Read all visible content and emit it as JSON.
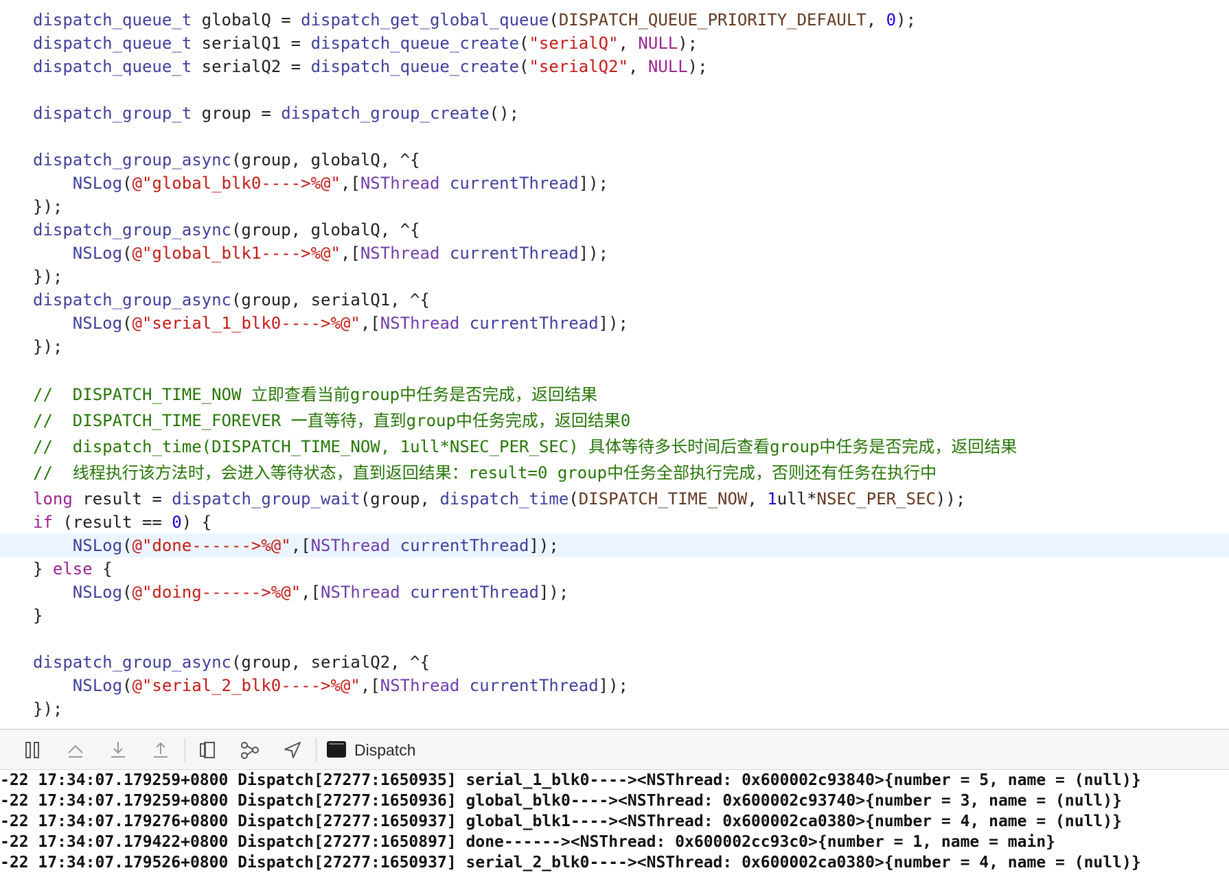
{
  "editor": {
    "lines": [
      [
        [
          "type",
          "dispatch_queue_t"
        ],
        [
          "plain",
          " globalQ = "
        ],
        [
          "func",
          "dispatch_get_global_queue"
        ],
        [
          "plain",
          "("
        ],
        [
          "macro",
          "DISPATCH_QUEUE_PRIORITY_DEFAULT"
        ],
        [
          "plain",
          ", "
        ],
        [
          "num",
          "0"
        ],
        [
          "plain",
          ");"
        ]
      ],
      [
        [
          "type",
          "dispatch_queue_t"
        ],
        [
          "plain",
          " serialQ1 = "
        ],
        [
          "func",
          "dispatch_queue_create"
        ],
        [
          "plain",
          "("
        ],
        [
          "str",
          "\"serialQ\""
        ],
        [
          "plain",
          ", "
        ],
        [
          "kw",
          "NULL"
        ],
        [
          "plain",
          ");"
        ]
      ],
      [
        [
          "type",
          "dispatch_queue_t"
        ],
        [
          "plain",
          " serialQ2 = "
        ],
        [
          "func",
          "dispatch_queue_create"
        ],
        [
          "plain",
          "("
        ],
        [
          "str",
          "\"serialQ2\""
        ],
        [
          "plain",
          ", "
        ],
        [
          "kw",
          "NULL"
        ],
        [
          "plain",
          ");"
        ]
      ],
      [],
      [
        [
          "type",
          "dispatch_group_t"
        ],
        [
          "plain",
          " group = "
        ],
        [
          "func",
          "dispatch_group_create"
        ],
        [
          "plain",
          "();"
        ]
      ],
      [],
      [
        [
          "func",
          "dispatch_group_async"
        ],
        [
          "plain",
          "(group, globalQ, ^{"
        ]
      ],
      [
        [
          "plain",
          "    "
        ],
        [
          "func",
          "NSLog"
        ],
        [
          "plain",
          "("
        ],
        [
          "str",
          "@\"global_blk0---->%@\""
        ],
        [
          "plain",
          ",["
        ],
        [
          "cls",
          "NSThread"
        ],
        [
          "plain",
          " "
        ],
        [
          "func",
          "currentThread"
        ],
        [
          "plain",
          "]);"
        ]
      ],
      [
        [
          "plain",
          "});"
        ]
      ],
      [
        [
          "func",
          "dispatch_group_async"
        ],
        [
          "plain",
          "(group, globalQ, ^{"
        ]
      ],
      [
        [
          "plain",
          "    "
        ],
        [
          "func",
          "NSLog"
        ],
        [
          "plain",
          "("
        ],
        [
          "str",
          "@\"global_blk1---->%@\""
        ],
        [
          "plain",
          ",["
        ],
        [
          "cls",
          "NSThread"
        ],
        [
          "plain",
          " "
        ],
        [
          "func",
          "currentThread"
        ],
        [
          "plain",
          "]);"
        ]
      ],
      [
        [
          "plain",
          "});"
        ]
      ],
      [
        [
          "func",
          "dispatch_group_async"
        ],
        [
          "plain",
          "(group, serialQ1, ^{"
        ]
      ],
      [
        [
          "plain",
          "    "
        ],
        [
          "func",
          "NSLog"
        ],
        [
          "plain",
          "("
        ],
        [
          "str",
          "@\"serial_1_blk0---->%@\""
        ],
        [
          "plain",
          ",["
        ],
        [
          "cls",
          "NSThread"
        ],
        [
          "plain",
          " "
        ],
        [
          "func",
          "currentThread"
        ],
        [
          "plain",
          "]);"
        ]
      ],
      [
        [
          "plain",
          "});"
        ]
      ],
      [],
      [
        [
          "cmt",
          "//  DISPATCH_TIME_NOW 立即查看当前group中任务是否完成，返回结果"
        ]
      ],
      [
        [
          "cmt",
          "//  DISPATCH_TIME_FOREVER 一直等待，直到group中任务完成，返回结果0"
        ]
      ],
      [
        [
          "cmt",
          "//  dispatch_time(DISPATCH_TIME_NOW, 1ull*NSEC_PER_SEC) 具体等待多长时间后查看group中任务是否完成，返回结果"
        ]
      ],
      [
        [
          "cmt",
          "//  线程执行该方法时，会进入等待状态，直到返回结果：result=0 group中任务全部执行完成，否则还有任务在执行中"
        ]
      ],
      [
        [
          "kw",
          "long"
        ],
        [
          "plain",
          " result = "
        ],
        [
          "func",
          "dispatch_group_wait"
        ],
        [
          "plain",
          "(group, "
        ],
        [
          "func",
          "dispatch_time"
        ],
        [
          "plain",
          "("
        ],
        [
          "macro",
          "DISPATCH_TIME_NOW"
        ],
        [
          "plain",
          ", "
        ],
        [
          "num",
          "1"
        ],
        [
          "plain",
          "ull*"
        ],
        [
          "macro",
          "NSEC_PER_SEC"
        ],
        [
          "plain",
          "));"
        ]
      ],
      [
        [
          "kw",
          "if"
        ],
        [
          "plain",
          " (result == "
        ],
        [
          "num",
          "0"
        ],
        [
          "plain",
          ") {"
        ]
      ],
      [
        [
          "plain",
          "    "
        ],
        [
          "func",
          "NSLog"
        ],
        [
          "plain",
          "("
        ],
        [
          "str",
          "@\"done------>%@\""
        ],
        [
          "plain",
          ",["
        ],
        [
          "cls",
          "NSThread"
        ],
        [
          "plain",
          " "
        ],
        [
          "func",
          "currentThread"
        ],
        [
          "plain",
          "]);"
        ]
      ],
      [
        [
          "plain",
          "} "
        ],
        [
          "kw",
          "else"
        ],
        [
          "plain",
          " {"
        ]
      ],
      [
        [
          "plain",
          "    "
        ],
        [
          "func",
          "NSLog"
        ],
        [
          "plain",
          "("
        ],
        [
          "str",
          "@\"doing------>%@\""
        ],
        [
          "plain",
          ",["
        ],
        [
          "cls",
          "NSThread"
        ],
        [
          "plain",
          " "
        ],
        [
          "func",
          "currentThread"
        ],
        [
          "plain",
          "]);"
        ]
      ],
      [
        [
          "plain",
          "}"
        ]
      ],
      [],
      [
        [
          "func",
          "dispatch_group_async"
        ],
        [
          "plain",
          "(group, serialQ2, ^{"
        ]
      ],
      [
        [
          "plain",
          "    "
        ],
        [
          "func",
          "NSLog"
        ],
        [
          "plain",
          "("
        ],
        [
          "str",
          "@\"serial_2_blk0---->%@\""
        ],
        [
          "plain",
          ",["
        ],
        [
          "cls",
          "NSThread"
        ],
        [
          "plain",
          " "
        ],
        [
          "func",
          "currentThread"
        ],
        [
          "plain",
          "]);"
        ]
      ],
      [
        [
          "plain",
          "});"
        ]
      ]
    ]
  },
  "debug_bar": {
    "target_label": "Dispatch",
    "icons": [
      "toggle-console-icon",
      "step-over-icon",
      "step-into-icon",
      "step-out-icon",
      "view-hierarchy-icon",
      "memory-graph-icon",
      "simulate-location-icon"
    ]
  },
  "console": {
    "lines": [
      "-22 17:34:07.179259+0800 Dispatch[27277:1650935] serial_1_blk0----><NSThread: 0x600002c93840>{number = 5, name = (null)}",
      "-22 17:34:07.179259+0800 Dispatch[27277:1650936] global_blk0----><NSThread: 0x600002c93740>{number = 3, name = (null)}",
      "-22 17:34:07.179276+0800 Dispatch[27277:1650937] global_blk1----><NSThread: 0x600002ca0380>{number = 4, name = (null)}",
      "-22 17:34:07.179422+0800 Dispatch[27277:1650897] done------><NSThread: 0x600002cc93c0>{number = 1, name = main}",
      "-22 17:34:07.179526+0800 Dispatch[27277:1650937] serial_2_blk0----><NSThread: 0x600002ca0380>{number = 4, name = (null)}"
    ]
  }
}
